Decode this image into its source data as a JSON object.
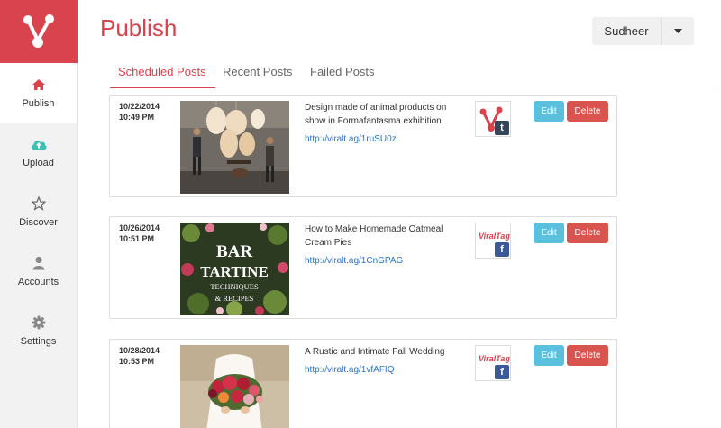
{
  "page": {
    "title": "Publish"
  },
  "user": {
    "name": "Sudheer"
  },
  "sidebar": {
    "items": [
      {
        "label": "Publish",
        "icon": "home-icon",
        "active": true
      },
      {
        "label": "Upload",
        "icon": "cloud-upload-icon",
        "active": false
      },
      {
        "label": "Discover",
        "icon": "star-icon",
        "active": false
      },
      {
        "label": "Accounts",
        "icon": "user-icon",
        "active": false
      },
      {
        "label": "Settings",
        "icon": "gear-icon",
        "active": false
      }
    ]
  },
  "tabs": [
    {
      "label": "Scheduled Posts",
      "active": true
    },
    {
      "label": "Recent Posts",
      "active": false
    },
    {
      "label": "Failed Posts",
      "active": false
    }
  ],
  "posts": [
    {
      "date": "10/22/2014",
      "time": "10:49 PM",
      "title": "Design made of animal products on show in Formafantasma exhibition",
      "link": "http://viralt.ag/1ruSU0z",
      "network": "tumblr",
      "edit_label": "Edit",
      "delete_label": "Delete"
    },
    {
      "date": "10/26/2014",
      "time": "10:51 PM",
      "title": "How to Make Homemade Oatmeal Cream Pies",
      "link": "http://viralt.ag/1CnGPAG",
      "network": "facebook",
      "thumb_text": [
        "BAR",
        "TARTINE",
        "TECHNIQUES",
        "& RECIPES"
      ],
      "edit_label": "Edit",
      "delete_label": "Delete"
    },
    {
      "date": "10/28/2014",
      "time": "10:53 PM",
      "title": "A Rustic and Intimate Fall Wedding",
      "link": "http://viralt.ag/1vfAFIQ",
      "network": "facebook",
      "edit_label": "Edit",
      "delete_label": "Delete"
    }
  ],
  "network_logo_text": "ViralTag",
  "colors": {
    "brand": "#d9434e",
    "edit": "#5bc0de",
    "delete": "#d9534f",
    "link": "#2b75c7",
    "facebook": "#3b5998",
    "tumblr": "#35465c"
  }
}
